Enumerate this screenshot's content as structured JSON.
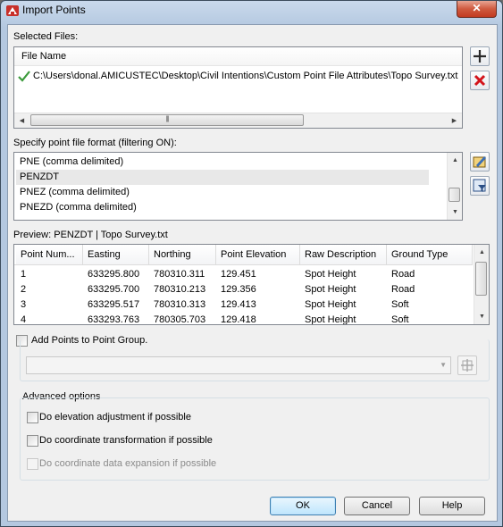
{
  "window": {
    "title": "Import Points",
    "close_glyph": "✕",
    "icons": {
      "app": "autocad-red-icon",
      "close": "close-icon"
    }
  },
  "selected_files": {
    "label": "Selected Files:",
    "column_header": "File Name",
    "files": [
      {
        "path": "C:\\Users\\donal.AMICUSTEC\\Desktop\\Civil Intentions\\Custom Point File Attributes\\Topo Survey.txt",
        "status_icon": "green-checkmark-icon"
      }
    ],
    "hscroll_thumb": "|||",
    "add_icon": "plus-icon",
    "remove_icon": "red-x-icon"
  },
  "format": {
    "label": "Specify point file format (filtering ON):",
    "items": [
      "PNE (comma delimited)",
      "PENZDT",
      "PNEZ (comma delimited)",
      "PNEZD (comma delimited)"
    ],
    "selected_index": 1,
    "edit_icon": "edit-format-icon",
    "filter_icon": "filter-icon"
  },
  "preview": {
    "label": "Preview: PENZDT | Topo Survey.txt",
    "columns": [
      "Point Num...",
      "Easting",
      "Northing",
      "Point Elevation",
      "Raw Description",
      "Ground Type"
    ],
    "rows": [
      [
        "1",
        "633295.800",
        "780310.311",
        "129.451",
        "Spot Height",
        "Road"
      ],
      [
        "2",
        "633295.700",
        "780310.213",
        "129.356",
        "Spot Height",
        "Road"
      ],
      [
        "3",
        "633295.517",
        "780310.313",
        "129.413",
        "Spot Height",
        "Soft"
      ],
      [
        "4",
        "633293.763",
        "780305.703",
        "129.418",
        "Spot Height",
        "Soft"
      ]
    ]
  },
  "point_group": {
    "label": "Add Points to Point Group.",
    "checked": false,
    "combo_value": "",
    "create_icon": "point-group-icon"
  },
  "advanced": {
    "label": "Advanced options",
    "options": [
      {
        "label": "Do elevation adjustment if possible",
        "checked": false,
        "enabled": true
      },
      {
        "label": "Do coordinate transformation if possible",
        "checked": false,
        "enabled": true
      },
      {
        "label": "Do coordinate data expansion if possible",
        "checked": false,
        "enabled": false
      }
    ]
  },
  "buttons": {
    "ok": "OK",
    "cancel": "Cancel",
    "help": "Help"
  }
}
